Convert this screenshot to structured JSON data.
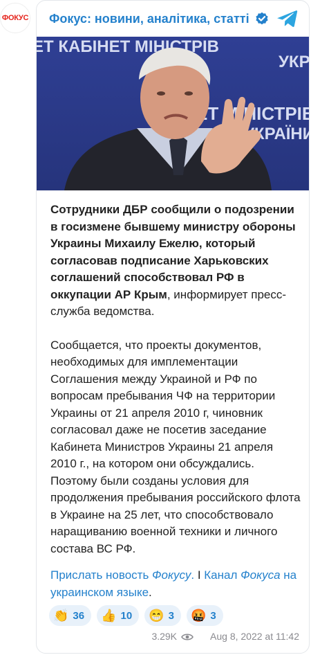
{
  "avatar": {
    "text": "ФОКУС"
  },
  "channel": {
    "name": "Фокус: новини, аналітика, статті",
    "verified_color": "#2481cc",
    "brand_color": "#e5231b"
  },
  "photo": {
    "banner_line1": "ЕТ КАБІНЕТ МІНІСТРІВ",
    "banner_line2": "УКРА",
    "banner_line3": "ЕТ МІНІСТРІВ",
    "banner_line4": "УКРАЇНИ"
  },
  "post": {
    "bold_part": "Сотрудники ДБР сообщили о подозрении в госизмене бывшему министру обороны Украины Михаилу Ежелю, который согласовав подписание Харьковских соглашений способствовал РФ в оккупации АР Крым",
    "rest_part": ", информирует пресс-служба ведомства.",
    "paragraph2": "Сообщается, что проекты документов, необходимых для имплементации Соглашения между Украиной и РФ по вопросам пребывания ЧФ на территории Украины от 21 апреля 2010 г, чиновник согласовал даже не посетив заседание Кабинета Министров Украины 21 апреля 2010 г., на котором они обсуждались. Поэтому были созданы условия для продолжения пребывания российского флота в Украине на 25 лет, что способствовало наращиванию военной техники и личного состава ВС РФ."
  },
  "links": {
    "link1_prefix": "Прислать новость ",
    "link1_italic": "Фокусу",
    "link1_suffix": ".",
    "separator": " I ",
    "link2_prefix": "Канал ",
    "link2_italic": "Фокуса",
    "link2_suffix": " на украинском языке",
    "end": "."
  },
  "reactions": [
    {
      "emoji": "👏",
      "count": "36"
    },
    {
      "emoji": "👍",
      "count": "10"
    },
    {
      "emoji": "😁",
      "count": "3"
    },
    {
      "emoji": "🤬",
      "count": "3"
    }
  ],
  "meta": {
    "views": "3.29K",
    "date": "Aug 8, 2022 at 11:42"
  }
}
